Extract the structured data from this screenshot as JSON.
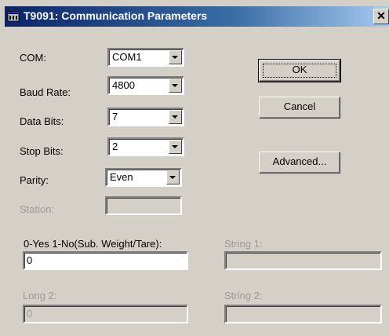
{
  "window": {
    "title": "T9091: Communication Parameters",
    "close_glyph": "✕"
  },
  "fields": {
    "com": {
      "label": "COM:",
      "value": "COM1"
    },
    "baud_rate": {
      "label": "Baud Rate:",
      "value": "4800"
    },
    "data_bits": {
      "label": "Data Bits:",
      "value": "7"
    },
    "stop_bits": {
      "label": "Stop Bits:",
      "value": "2"
    },
    "parity": {
      "label": "Parity:",
      "value": "Even"
    },
    "station": {
      "label": "Station:",
      "value": ""
    },
    "sub_weight": {
      "label": "0-Yes 1-No(Sub. Weight/Tare):",
      "value": "0"
    },
    "string1": {
      "label": "String 1:",
      "value": ""
    },
    "long2": {
      "label": "Long 2:",
      "value": "0"
    },
    "string2": {
      "label": "String 2:",
      "value": ""
    }
  },
  "buttons": {
    "ok": "OK",
    "cancel": "Cancel",
    "advanced": "Advanced..."
  },
  "colors": {
    "face": "#d4d0c8",
    "title_active": "#0a246a",
    "disabled_text": "#9a9a9a"
  },
  "icons": {
    "title": "app-window-icon",
    "close": "close-icon",
    "dropdown": "chevron-down-icon"
  }
}
